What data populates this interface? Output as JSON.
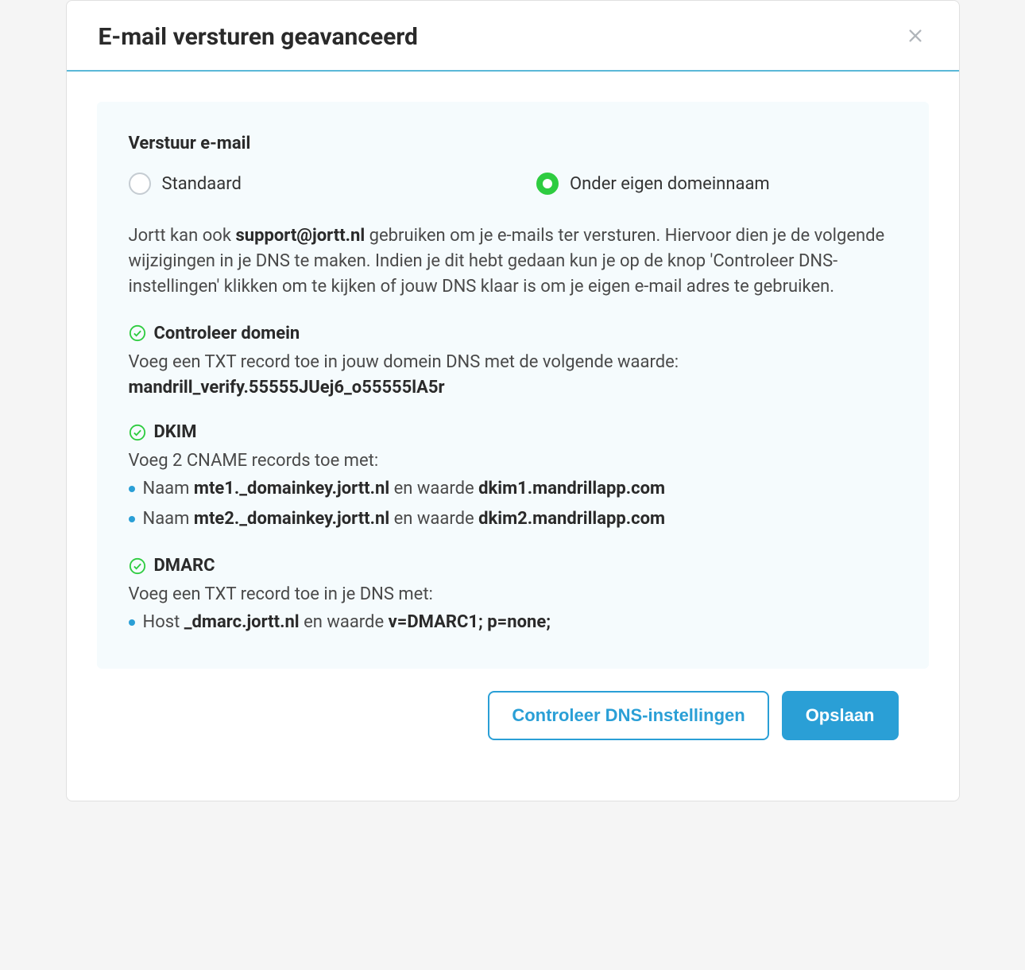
{
  "modal": {
    "title": "E-mail versturen geavanceerd"
  },
  "panel": {
    "heading": "Verstuur e-mail",
    "radio": {
      "standard": "Standaard",
      "own_domain": "Onder eigen domeinnaam"
    },
    "description": {
      "before": "Jortt kan ook ",
      "email": "support@jortt.nl",
      "after": " gebruiken om je e-mails ter versturen. Hiervoor dien je de volgende wijzigingen in je DNS te maken. Indien je dit hebt gedaan kun je op de knop 'Controleer DNS-instellingen' klikken om te kijken of jouw DNS klaar is om je eigen e-mail adres te gebruiken."
    },
    "sections": {
      "domain": {
        "title": "Controleer domein",
        "desc": "Voeg een TXT record toe in jouw domein DNS met de volgende waarde:",
        "value": "mandrill_verify.55555JUej6_o55555lA5r"
      },
      "dkim": {
        "title": "DKIM",
        "desc": "Voeg 2 CNAME records toe met:",
        "items": [
          {
            "prefix": "Naam ",
            "name": "mte1._domainkey.jortt.nl",
            "mid": " en waarde ",
            "value": "dkim1.mandrillapp.com"
          },
          {
            "prefix": "Naam ",
            "name": "mte2._domainkey.jortt.nl",
            "mid": " en waarde ",
            "value": "dkim2.mandrillapp.com"
          }
        ]
      },
      "dmarc": {
        "title": "DMARC",
        "desc": "Voeg een TXT record toe in je DNS met:",
        "item": {
          "prefix": "Host ",
          "name": "_dmarc.jortt.nl",
          "mid": " en waarde ",
          "value": "v=DMARC1; p=none;"
        }
      }
    }
  },
  "footer": {
    "check_dns": "Controleer DNS-instellingen",
    "save": "Opslaan"
  }
}
